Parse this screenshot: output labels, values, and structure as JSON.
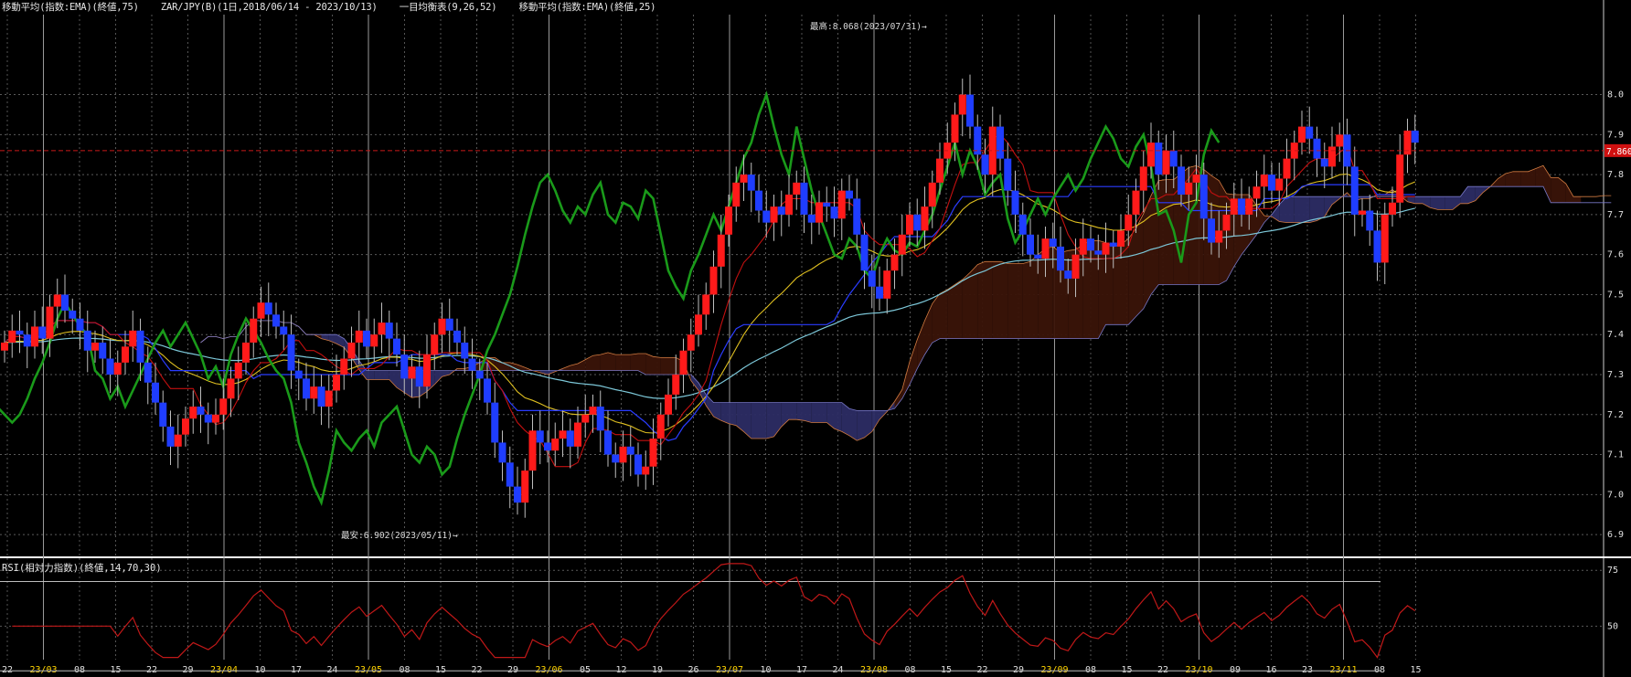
{
  "header": {
    "ema75": "移動平均(指数:EMA)(終値,75)",
    "symbol": "ZAR/JPY(B)(1日,2018/06/14 - 2023/10/13)",
    "ichimoku": "一目均衡表(9,26,52)",
    "ema25": "移動平均(指数:EMA)(終値,25)"
  },
  "rsi_header": "RSI(相対力指数)(終値,14,70,30)",
  "annotations": {
    "high": "最高:8.068(2023/07/31)→",
    "low": "最安:6.902(2023/05/11)→"
  },
  "current_price_tag": "7.860",
  "colors": {
    "up": "#ff1a1a",
    "down": "#1f3dff",
    "kijun": "#2a3cff",
    "tenkan": "#c41010",
    "ema25": "#e0c020",
    "ema75": "#7cc7d8",
    "chikou": "#1a9a1a",
    "kumo_bull": "#3a1408",
    "kumo_bear": "#2c2c64",
    "rsi": "#c01818"
  },
  "chart_data": [
    {
      "type": "line",
      "subtype": "candlestick",
      "title": "ZAR/JPY(B)(1日,2018/06/14 - 2023/10/13)",
      "ylim": [
        6.85,
        8.2
      ],
      "y_ticks": [
        "8.0",
        "7.9",
        "7.8",
        "7.7",
        "7.6",
        "7.5",
        "7.4",
        "7.3",
        "7.2",
        "7.1",
        "7.0",
        "6.9"
      ],
      "x_ticks": [
        {
          "label": "22",
          "major": false
        },
        {
          "label": "23/03",
          "major": true
        },
        {
          "label": "08",
          "major": false
        },
        {
          "label": "15",
          "major": false
        },
        {
          "label": "22",
          "major": false
        },
        {
          "label": "29",
          "major": false
        },
        {
          "label": "23/04",
          "major": true
        },
        {
          "label": "10",
          "major": false
        },
        {
          "label": "17",
          "major": false
        },
        {
          "label": "24",
          "major": false
        },
        {
          "label": "23/05",
          "major": true
        },
        {
          "label": "08",
          "major": false
        },
        {
          "label": "15",
          "major": false
        },
        {
          "label": "22",
          "major": false
        },
        {
          "label": "29",
          "major": false
        },
        {
          "label": "23/06",
          "major": true
        },
        {
          "label": "05",
          "major": false
        },
        {
          "label": "12",
          "major": false
        },
        {
          "label": "19",
          "major": false
        },
        {
          "label": "26",
          "major": false
        },
        {
          "label": "23/07",
          "major": true
        },
        {
          "label": "10",
          "major": false
        },
        {
          "label": "17",
          "major": false
        },
        {
          "label": "24",
          "major": false
        },
        {
          "label": "23/08",
          "major": true
        },
        {
          "label": "08",
          "major": false
        },
        {
          "label": "15",
          "major": false
        },
        {
          "label": "22",
          "major": false
        },
        {
          "label": "29",
          "major": false
        },
        {
          "label": "23/09",
          "major": true
        },
        {
          "label": "08",
          "major": false
        },
        {
          "label": "15",
          "major": false
        },
        {
          "label": "22",
          "major": false
        },
        {
          "label": "23/10",
          "major": true
        },
        {
          "label": "09",
          "major": false
        },
        {
          "label": "16",
          "major": false
        },
        {
          "label": "23",
          "major": false
        },
        {
          "label": "23/11",
          "major": true
        },
        {
          "label": "08",
          "major": false
        },
        {
          "label": "15",
          "major": false
        }
      ],
      "close": [
        7.38,
        7.41,
        7.4,
        7.37,
        7.42,
        7.39,
        7.47,
        7.5,
        7.46,
        7.44,
        7.41,
        7.36,
        7.38,
        7.34,
        7.3,
        7.33,
        7.37,
        7.41,
        7.33,
        7.28,
        7.23,
        7.17,
        7.12,
        7.15,
        7.19,
        7.22,
        7.2,
        7.18,
        7.2,
        7.24,
        7.29,
        7.33,
        7.38,
        7.44,
        7.48,
        7.45,
        7.42,
        7.4,
        7.31,
        7.29,
        7.24,
        7.27,
        7.22,
        7.26,
        7.3,
        7.34,
        7.38,
        7.41,
        7.37,
        7.4,
        7.43,
        7.39,
        7.35,
        7.29,
        7.32,
        7.27,
        7.35,
        7.4,
        7.44,
        7.41,
        7.38,
        7.34,
        7.31,
        7.29,
        7.23,
        7.13,
        7.08,
        7.02,
        6.98,
        7.06,
        7.16,
        7.13,
        7.11,
        7.14,
        7.16,
        7.12,
        7.18,
        7.2,
        7.22,
        7.16,
        7.1,
        7.08,
        7.12,
        7.1,
        7.05,
        7.07,
        7.14,
        7.2,
        7.25,
        7.3,
        7.36,
        7.4,
        7.45,
        7.5,
        7.57,
        7.65,
        7.72,
        7.78,
        7.8,
        7.76,
        7.71,
        7.68,
        7.72,
        7.7,
        7.75,
        7.78,
        7.7,
        7.68,
        7.73,
        7.72,
        7.69,
        7.76,
        7.74,
        7.65,
        7.56,
        7.52,
        7.49,
        7.56,
        7.6,
        7.65,
        7.7,
        7.66,
        7.72,
        7.78,
        7.84,
        7.88,
        7.95,
        8.0,
        7.92,
        7.85,
        7.8,
        7.92,
        7.84,
        7.76,
        7.7,
        7.65,
        7.6,
        7.59,
        7.64,
        7.62,
        7.56,
        7.54,
        7.6,
        7.64,
        7.61,
        7.6,
        7.63,
        7.62,
        7.66,
        7.7,
        7.76,
        7.82,
        7.88,
        7.8,
        7.86,
        7.82,
        7.75,
        7.78,
        7.8,
        7.69,
        7.63,
        7.66,
        7.7,
        7.74,
        7.7,
        7.74,
        7.77,
        7.8,
        7.76,
        7.79,
        7.84,
        7.88,
        7.92,
        7.89,
        7.84,
        7.82,
        7.87,
        7.9,
        7.82,
        7.7,
        7.71,
        7.66,
        7.58,
        7.7,
        7.73,
        7.85,
        7.91,
        7.88
      ],
      "ichimoku": {
        "tenkan": "red line",
        "kijun": "blue line",
        "chikou": "green line"
      },
      "ema": {
        "periods": [
          25,
          75
        ]
      },
      "high_label": "最高:8.068(2023/07/31)→",
      "low_label": "最安:6.902(2023/05/11)→",
      "current_price": 7.86
    },
    {
      "type": "line",
      "title": "RSI(相対力指数)(終値,14,70,30)",
      "ylim": [
        35,
        80
      ],
      "y_ticks": [
        "75",
        "50"
      ],
      "reference_lines": [
        70,
        30
      ]
    }
  ]
}
